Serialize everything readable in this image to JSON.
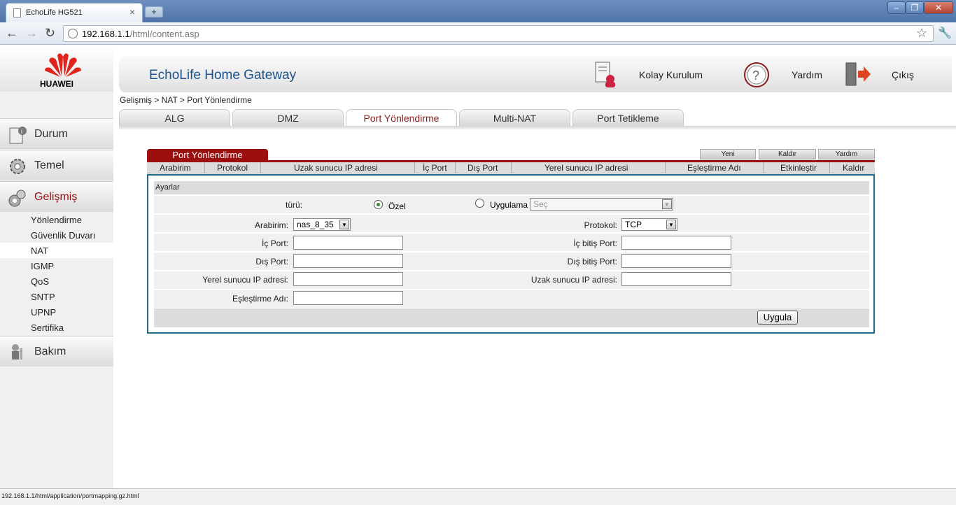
{
  "browser": {
    "tab_title": "EchoLife HG521",
    "new_tab_symbol": "+",
    "url_host": "192.168.1.1",
    "url_path": "/html/content.asp",
    "status_url": "192.168.1.1/html/application/portmapping.gz.html"
  },
  "sidebar": {
    "brand": "HUAWEI",
    "sections": [
      "Durum",
      "Temel",
      "Gelişmiş",
      "Bakım"
    ],
    "sub_items": [
      "Yönlendirme",
      "Güvenlik Duvarı",
      "NAT",
      "IGMP",
      "QoS",
      "SNTP",
      "UPNP",
      "Sertifika"
    ],
    "selected_sub": "NAT"
  },
  "header": {
    "title": "EchoLife Home Gateway",
    "quick_setup": "Kolay Kurulum",
    "help": "Yardım",
    "logout": "Çıkış"
  },
  "breadcrumb": "Gelişmiş > NAT > Port Yönlendirme",
  "tabs": [
    "ALG",
    "DMZ",
    "Port Yönlendirme",
    "Multi-NAT",
    "Port Tetikleme"
  ],
  "active_tab": "Port Yönlendirme",
  "table": {
    "title": "Port Yönlendirme",
    "buttons": [
      "Yeni",
      "Kaldır",
      "Yardım"
    ],
    "columns": [
      "Arabirim",
      "Protokol",
      "Uzak sunucu IP adresi",
      "İç Port",
      "Dış Port",
      "Yerel sunucu IP adresi",
      "Eşleştirme Adı",
      "Etkinleştir",
      "Kaldır"
    ]
  },
  "form": {
    "section": "Ayarlar",
    "type_label": "türü:",
    "type_custom": "Özel",
    "type_app": "Uygulama",
    "app_select": "Seç",
    "interface_label": "Arabirim:",
    "interface_value": "nas_8_35",
    "protocol_label": "Protokol:",
    "protocol_value": "TCP",
    "inner_port_label": "İç Port:",
    "inner_end_port_label": "İç bitiş Port:",
    "outer_port_label": "Dış Port:",
    "outer_end_port_label": "Dış bitiş Port:",
    "local_ip_label": "Yerel sunucu IP adresi:",
    "remote_ip_label": "Uzak sunucu IP adresi:",
    "mapping_name_label": "Eşleştirme Adı:",
    "apply": "Uygula"
  },
  "colors": {
    "accent": "#9d0f0f",
    "title_blue": "#1d5390",
    "panel_border": "#1f6a8a"
  }
}
